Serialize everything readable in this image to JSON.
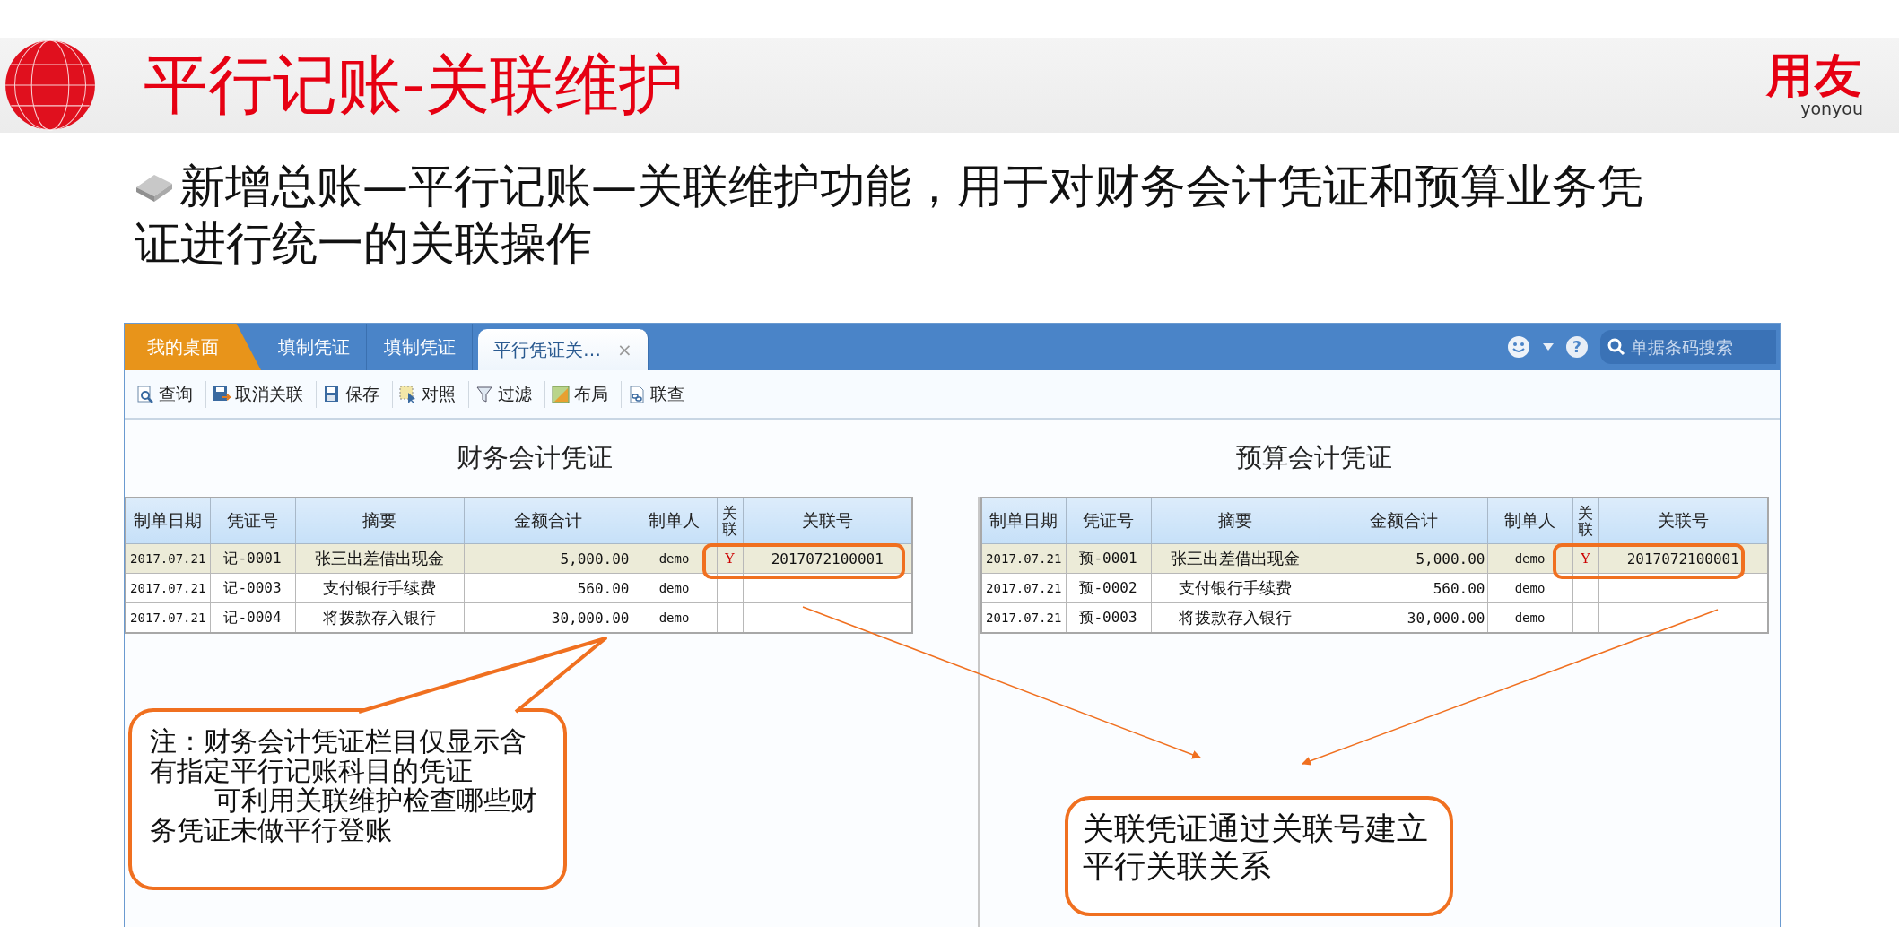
{
  "slide": {
    "title": "平行记账-关联维护",
    "logo": {
      "text": "用友",
      "subtext": "yonyou"
    },
    "bullet": "新增总账—平行记账—关联维护功能，用于对财务会计凭证和预算业务凭证进行统一的关联操作"
  },
  "app": {
    "tabs": [
      {
        "label": "我的桌面",
        "kind": "home",
        "selected": false
      },
      {
        "label": "填制凭证",
        "kind": "doc",
        "selected": false
      },
      {
        "label": "填制凭证",
        "kind": "doc",
        "selected": false
      },
      {
        "label": "平行凭证关…",
        "kind": "doc",
        "selected": true,
        "close": "×"
      }
    ],
    "help": "?",
    "search": {
      "placeholder": "单据条码搜索"
    },
    "toolbar": [
      {
        "label": "查询"
      },
      {
        "label": "取消关联"
      },
      {
        "label": "保存"
      },
      {
        "label": "对照"
      },
      {
        "label": "过滤"
      },
      {
        "label": "布局"
      },
      {
        "label": "联查"
      }
    ],
    "panels": [
      {
        "title": "财务会计凭证",
        "columns": [
          "制单日期",
          "凭证号",
          "摘要",
          "金额合计",
          "制单人",
          "关联",
          "关联号"
        ],
        "rows": [
          {
            "date": "2017.07.21",
            "voucher_no": "记-0001",
            "summary": "张三出差借出现金",
            "amount": "5,000.00",
            "maker": "demo",
            "linked": "Y",
            "link_no": "2017072100001",
            "selected": true
          },
          {
            "date": "2017.07.21",
            "voucher_no": "记-0003",
            "summary": "支付银行手续费",
            "amount": "560.00",
            "maker": "demo",
            "selected": false
          },
          {
            "date": "2017.07.21",
            "voucher_no": "记-0004",
            "summary": "将拨款存入银行",
            "amount": "30,000.00",
            "maker": "demo",
            "selected": false
          }
        ]
      },
      {
        "title": "预算会计凭证",
        "columns": [
          "制单日期",
          "凭证号",
          "摘要",
          "金额合计",
          "制单人",
          "关联",
          "关联号"
        ],
        "rows": [
          {
            "date": "2017.07.21",
            "voucher_no": "预-0001",
            "summary": "张三出差借出现金",
            "amount": "5,000.00",
            "maker": "demo",
            "linked": "Y",
            "link_no": "2017072100001",
            "selected": true
          },
          {
            "date": "2017.07.21",
            "voucher_no": "预-0002",
            "summary": "支付银行手续费",
            "amount": "560.00",
            "maker": "demo",
            "selected": false
          },
          {
            "date": "2017.07.21",
            "voucher_no": "预-0003",
            "summary": "将拨款存入银行",
            "amount": "30,000.00",
            "maker": "demo",
            "selected": false
          }
        ]
      }
    ]
  },
  "callouts": [
    {
      "paragraphs": [
        "注：财务会计凭证栏目仅显示含有指定平行记账科目的凭证",
        "可利用关联维护检查哪些财务凭证未做平行登账"
      ]
    },
    {
      "paragraphs": [
        "关联凭证通过关联号建立平行关联关系"
      ]
    }
  ]
}
